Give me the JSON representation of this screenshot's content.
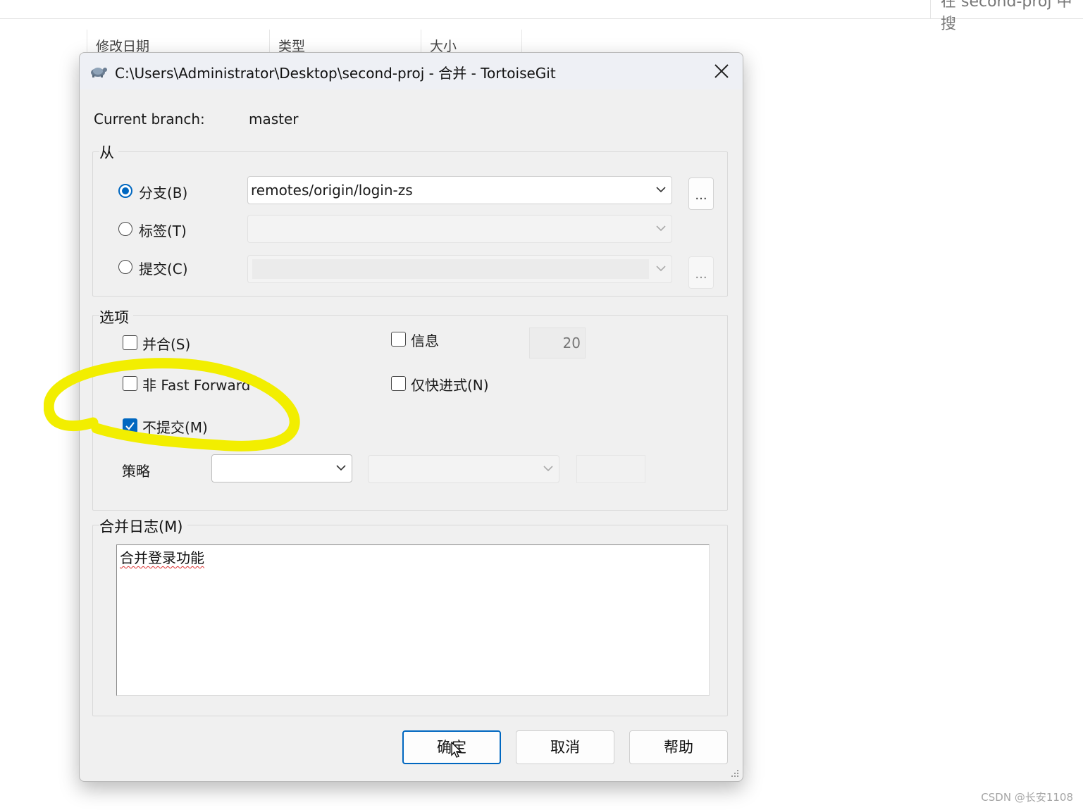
{
  "background": {
    "top_clipped_text": "在 second-proj 中搜",
    "columns": [
      "修改日期",
      "类型",
      "大小"
    ]
  },
  "dialog": {
    "title": "C:\\Users\\Administrator\\Desktop\\second-proj - 合并 - TortoiseGit",
    "current_branch_label": "Current branch:",
    "current_branch_value": "master",
    "from_group": {
      "legend": "从",
      "branch_label": "分支(B)",
      "branch_value": "remotes/origin/login-zs",
      "tag_label": "标签(T)",
      "commit_label": "提交(C)",
      "browse_label": "..."
    },
    "options_group": {
      "legend": "选项",
      "squash_label": "并合(S)",
      "no_ff_label": "非 Fast Forward",
      "no_commit_label": "不提交(M)",
      "log_label": "信息",
      "log_count": "20",
      "ff_only_label": "仅快进式(N)",
      "strategy_label": "策略"
    },
    "log_group": {
      "legend": "合并日志(M)",
      "message": "合并登录功能"
    },
    "buttons": {
      "ok": "确定",
      "cancel": "取消",
      "help": "帮助"
    },
    "state": {
      "branch_selected": true,
      "squash_checked": false,
      "no_ff_checked": false,
      "no_commit_checked": true,
      "log_checked": false,
      "ff_only_checked": false
    }
  },
  "watermark": "CSDN @长安1108",
  "colors": {
    "accent": "#0067c0",
    "annotation": "#f2ee00"
  }
}
